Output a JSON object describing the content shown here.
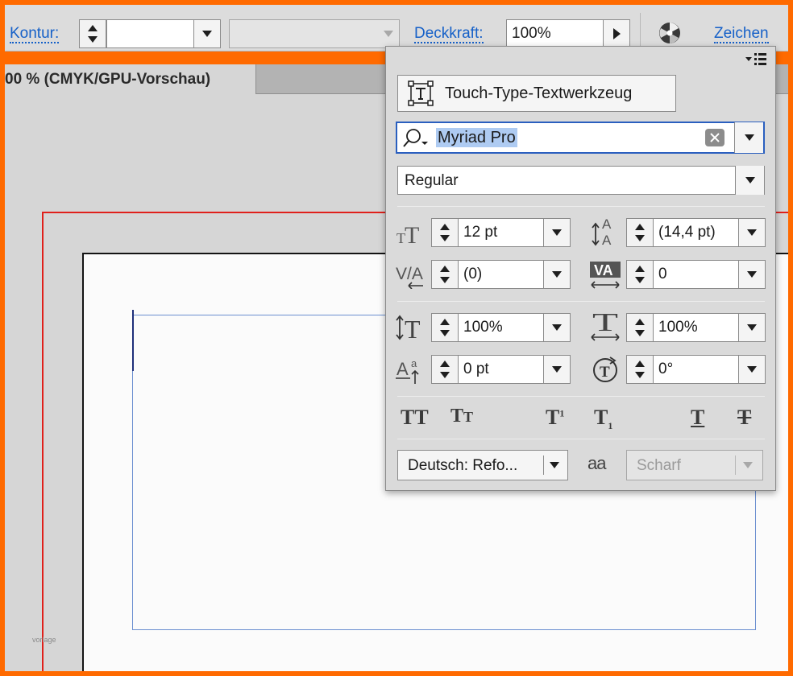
{
  "toolbar": {
    "stroke_label": "Kontur:",
    "opacity_label": "Deckkraft:",
    "opacity_value": "100%",
    "character_link": "Zeichen"
  },
  "document_tab": {
    "title": "00 % (CMYK/GPU-Vorschau)"
  },
  "character_panel": {
    "touch_type_button": "Touch-Type-Textwerkzeug",
    "font_family": "Myriad Pro",
    "font_style": "Regular",
    "font_size": "12 pt",
    "leading": "(14,4 pt)",
    "kerning": "(0)",
    "tracking": "0",
    "vertical_scale": "100%",
    "horizontal_scale": "100%",
    "baseline_shift": "0 pt",
    "character_rotation": "0°",
    "language": "Deutsch: Refo...",
    "antialiasing": "Scharf",
    "antialiasing_icon_text": "aa",
    "text_style_buttons": [
      "TT",
      "Tt",
      "T¹",
      "T₁",
      "T",
      "T"
    ]
  },
  "canvas": {
    "watermark": "vorlage"
  },
  "colors": {
    "frame_border": "#ff6a00",
    "link_blue": "#1560c8",
    "bleed_red": "#e0201b",
    "selection_blue": "#2a5fbf"
  }
}
